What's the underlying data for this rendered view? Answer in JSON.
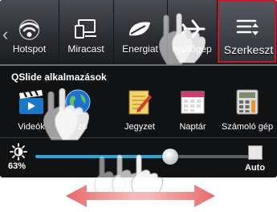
{
  "quick_settings": {
    "tiles": [
      {
        "label": "Hotspot",
        "icon": "wifi-hotspot-icon"
      },
      {
        "label": "Miracast",
        "icon": "miracast-icon"
      },
      {
        "label": "Energiat",
        "icon": "energy-saver-icon"
      },
      {
        "label": "epülőgép",
        "icon": "airplane-icon"
      },
      {
        "label": "Szerkeszt",
        "icon": "edit-list-icon"
      }
    ],
    "edit_highlight_color": "#c41b2c"
  },
  "qslide": {
    "title": "QSlide alkalmazások",
    "apps": [
      {
        "label": "Videók",
        "icon": "video-clapper-icon"
      },
      {
        "label": "ző",
        "icon": "globe-icon"
      },
      {
        "label": "Jegyzet",
        "icon": "notepad-icon"
      },
      {
        "label": "Naptár",
        "icon": "calendar-icon"
      },
      {
        "label": "Számoló gép",
        "icon": "calculator-icon"
      }
    ]
  },
  "brightness": {
    "value_label": "63%",
    "slider_fraction": 0.63,
    "auto_label": "Auto",
    "accent": "#2aa6dc"
  },
  "gesture": {
    "hint_icon": "hand-swipe-icon",
    "arrow_color": "#e86a6a"
  }
}
